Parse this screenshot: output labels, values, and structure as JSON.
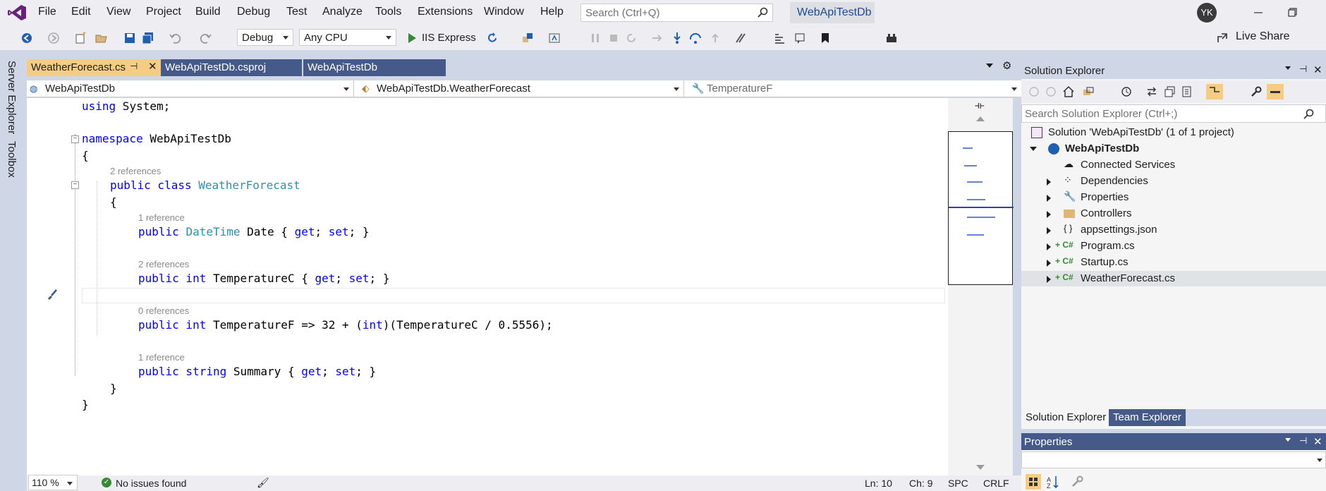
{
  "menubar": {
    "items": [
      "File",
      "Edit",
      "View",
      "Project",
      "Build",
      "Debug",
      "Test",
      "Analyze",
      "Tools",
      "Extensions",
      "Window",
      "Help"
    ],
    "search_placeholder": "Search (Ctrl+Q)",
    "solution_name": "WebApiTestDb",
    "user_initials": "YK"
  },
  "toolbar": {
    "config": "Debug",
    "platform": "Any CPU",
    "run_target": "IIS Express",
    "live_share": "Live Share"
  },
  "side_tabs": [
    "Server Explorer",
    "Toolbox"
  ],
  "doc_tabs": [
    {
      "label": "WeatherForecast.cs",
      "active": true
    },
    {
      "label": "WebApiTestDb.csproj",
      "active": false
    },
    {
      "label": "WebApiTestDb",
      "active": false
    }
  ],
  "navbar": {
    "project": "WebApiTestDb",
    "type": "WebApiTestDb.WeatherForecast",
    "member": "TemperatureF"
  },
  "code": {
    "using": "using System;",
    "ns_kw": "namespace",
    "ns_name": "WebApiTestDb",
    "brace_open": "{",
    "brace_close": "}",
    "ref2a": "2 references",
    "class_decl_kw": "public class",
    "class_name": "WeatherForecast",
    "ref1a": "1 reference",
    "l_date_kw": "public",
    "l_date_type": "DateTime",
    "l_date_rest": "Date { ",
    "get": "get",
    "set": "set",
    "ref2b": "2 references",
    "l_tc_kw": "public int",
    "l_tc_name": "TemperatureC { ",
    "ref0": "0 references",
    "l_tf_kw": "public int",
    "l_tf_rest": "TemperatureF => 32 + (",
    "l_tf_int": "int",
    "l_tf_end": ")(TemperatureC / 0.5556);",
    "ref1b": "1 reference",
    "l_sum_kw": "public string",
    "l_sum_rest": "Summary { "
  },
  "editor_status": {
    "zoom": "110 %",
    "issues": "No issues found",
    "line": "Ln: 10",
    "col": "Ch: 9",
    "ws": "SPC",
    "eol": "CRLF"
  },
  "solution_explorer": {
    "title": "Solution Explorer",
    "search_placeholder": "Search Solution Explorer (Ctrl+;)",
    "solution_label": "Solution 'WebApiTestDb' (1 of 1 project)",
    "project_label": "WebApiTestDb",
    "items": [
      "Connected Services",
      "Dependencies",
      "Properties",
      "Controllers",
      "appsettings.json",
      "Program.cs",
      "Startup.cs",
      "WeatherForecast.cs"
    ],
    "tab_solution": "Solution Explorer",
    "tab_team": "Team Explorer"
  },
  "properties": {
    "title": "Properties"
  },
  "colors": {
    "accent": "#68217a",
    "keyword": "#0000ff",
    "type": "#2b91af",
    "active_tab": "#f5cc84",
    "panel_header": "#465a8a"
  }
}
